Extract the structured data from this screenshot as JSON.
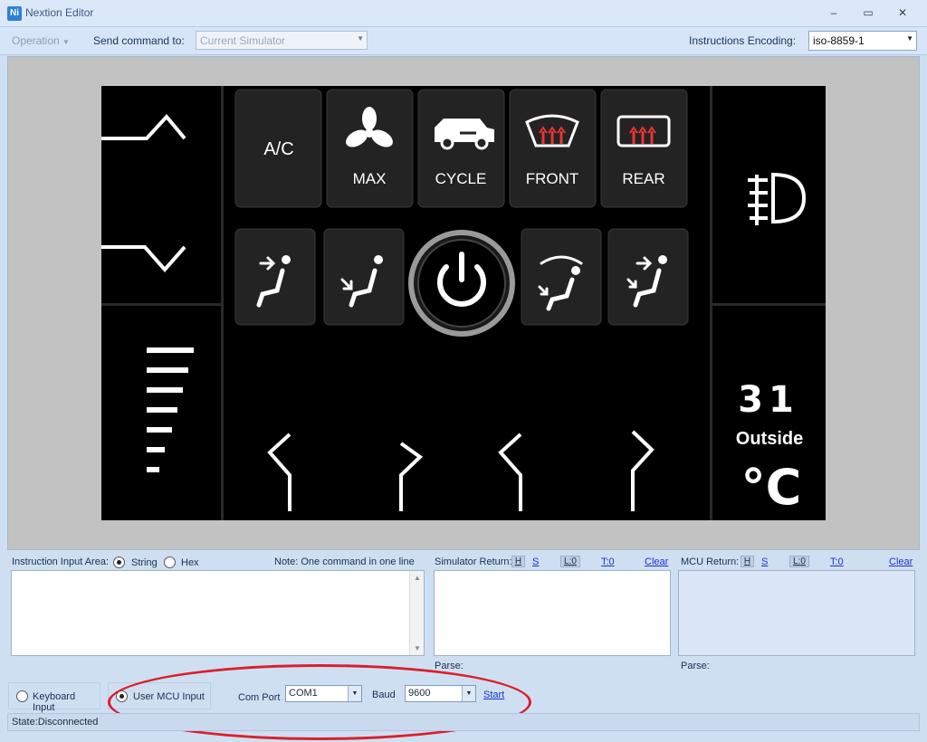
{
  "window": {
    "title": "Nextion Editor",
    "minimize": "–",
    "maximize": "▭",
    "close": "✕",
    "icon": "Ni"
  },
  "toolbar": {
    "operation_label": "Operation",
    "send_command_label": "Send command to:",
    "send_command_value": "Current Simulator",
    "encoding_label": "Instructions Encoding:",
    "encoding_value": "iso-8859-1"
  },
  "hmi": {
    "buttons_top": [
      "A/C",
      "MAX",
      "CYCLE",
      "FRONT",
      "REAR"
    ],
    "temperature_value": "31",
    "temperature_caption": "Outside",
    "temperature_unit": "°C",
    "icons": [
      "up-chevron-icon",
      "down-chevron-icon",
      "fan-speed-bars-icon",
      "fog-light-icon",
      "fan-icon",
      "car-recycle-icon",
      "front-defrost-icon",
      "rear-defrost-icon",
      "seat-airflow-face-icon",
      "seat-airflow-feet-icon",
      "power-icon",
      "seat-defrost-feet-icon",
      "seat-airflow-face-feet-icon"
    ]
  },
  "instruction": {
    "label": "Instruction Input Area:",
    "opt_string": "String",
    "opt_hex": "Hex",
    "selected": "String",
    "note": "Note: One command in one line",
    "value": ""
  },
  "simulator_return": {
    "label": "Simulator Return:",
    "h": "H",
    "s": "S",
    "l": "L:0",
    "t": "T:0",
    "clear": "Clear",
    "parse": "Parse:"
  },
  "mcu_return": {
    "label": "MCU Return:",
    "h": "H",
    "s": "S",
    "l": "L:0",
    "t": "T:0",
    "clear": "Clear",
    "parse": "Parse:"
  },
  "input_mode": {
    "keyboard": "Keyboard Input",
    "mcu": "User MCU Input",
    "selected": "User MCU Input"
  },
  "serial": {
    "com_label": "Com Port",
    "com_value": "COM1",
    "baud_label": "Baud",
    "baud_value": "9600",
    "start": "Start"
  },
  "status": "State:Disconnected",
  "colors": {
    "annotation": "#d9202b",
    "accent": "#2f7fd6"
  }
}
